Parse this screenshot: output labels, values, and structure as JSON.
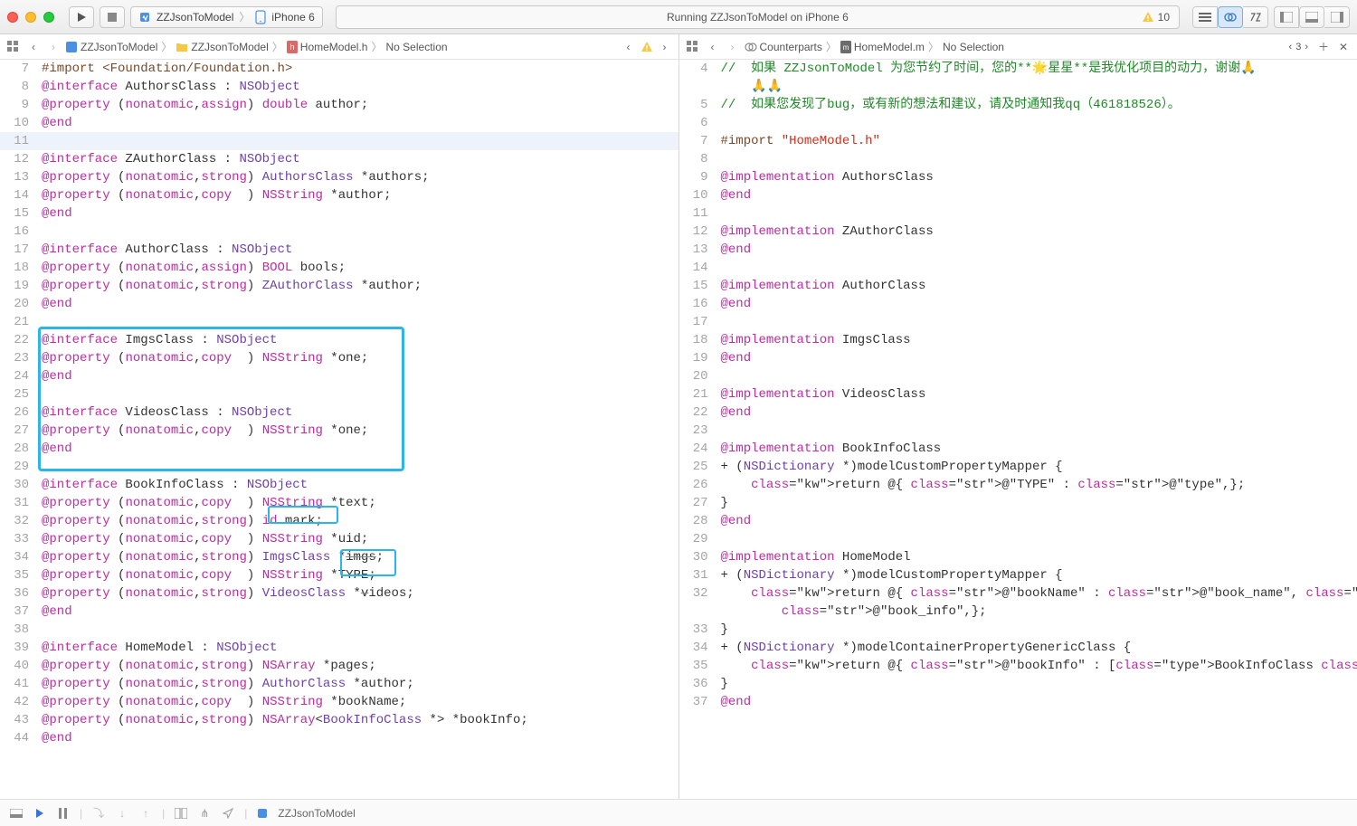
{
  "toolbar": {
    "scheme": "ZZJsonToModel",
    "destination": "iPhone 6",
    "status_text": "Running ZZJsonToModel on iPhone 6",
    "warning_count": "10"
  },
  "left_jump": {
    "project": "ZZJsonToModel",
    "folder": "ZZJsonToModel",
    "file": "HomeModel.h",
    "selection": "No Selection"
  },
  "right_jump": {
    "category": "Counterparts",
    "file": "HomeModel.m",
    "selection": "No Selection",
    "counter": "3"
  },
  "left_code": [
    {
      "n": "7",
      "t": "#import <Foundation/Foundation.h>",
      "c": "pre"
    },
    {
      "n": "8",
      "t": "@interface AuthorsClass : NSObject",
      "c": "int"
    },
    {
      "n": "9",
      "t": "@property (nonatomic,assign) double author;",
      "c": "prop2"
    },
    {
      "n": "10",
      "t": "@end",
      "c": "kw"
    },
    {
      "n": "11",
      "t": "",
      "c": "cur"
    },
    {
      "n": "12",
      "t": "@interface ZAuthorClass : NSObject",
      "c": "int"
    },
    {
      "n": "13",
      "t": "@property (nonatomic,strong) AuthorsClass *authors;",
      "c": "prop3"
    },
    {
      "n": "14",
      "t": "@property (nonatomic,copy  ) NSString *author;",
      "c": "prop"
    },
    {
      "n": "15",
      "t": "@end",
      "c": "kw"
    },
    {
      "n": "16",
      "t": "",
      "c": ""
    },
    {
      "n": "17",
      "t": "@interface AuthorClass : NSObject",
      "c": "int"
    },
    {
      "n": "18",
      "t": "@property (nonatomic,assign) BOOL bools;",
      "c": "prop2"
    },
    {
      "n": "19",
      "t": "@property (nonatomic,strong) ZAuthorClass *author;",
      "c": "prop3"
    },
    {
      "n": "20",
      "t": "@end",
      "c": "kw"
    },
    {
      "n": "21",
      "t": "",
      "c": ""
    },
    {
      "n": "22",
      "t": "@interface ImgsClass : NSObject",
      "c": "int"
    },
    {
      "n": "23",
      "t": "@property (nonatomic,copy  ) NSString *one;",
      "c": "prop"
    },
    {
      "n": "24",
      "t": "@end",
      "c": "kw"
    },
    {
      "n": "25",
      "t": "",
      "c": ""
    },
    {
      "n": "26",
      "t": "@interface VideosClass : NSObject",
      "c": "int"
    },
    {
      "n": "27",
      "t": "@property (nonatomic,copy  ) NSString *one;",
      "c": "prop"
    },
    {
      "n": "28",
      "t": "@end",
      "c": "kw"
    },
    {
      "n": "29",
      "t": "",
      "c": ""
    },
    {
      "n": "30",
      "t": "@interface BookInfoClass : NSObject",
      "c": "int"
    },
    {
      "n": "31",
      "t": "@property (nonatomic,copy  ) NSString *text;",
      "c": "prop"
    },
    {
      "n": "32",
      "t": "@property (nonatomic,strong) id mark;",
      "c": "prop2"
    },
    {
      "n": "33",
      "t": "@property (nonatomic,copy  ) NSString *uid;",
      "c": "prop"
    },
    {
      "n": "34",
      "t": "@property (nonatomic,strong) ImgsClass *imgs;",
      "c": "prop3s"
    },
    {
      "n": "35",
      "t": "@property (nonatomic,copy  ) NSString *TYPE;",
      "c": "prop"
    },
    {
      "n": "36",
      "t": "@property (nonatomic,strong) VideosClass *videos;",
      "c": "prop3s2"
    },
    {
      "n": "37",
      "t": "@end",
      "c": "kw"
    },
    {
      "n": "38",
      "t": "",
      "c": ""
    },
    {
      "n": "39",
      "t": "@interface HomeModel : NSObject",
      "c": "int"
    },
    {
      "n": "40",
      "t": "@property (nonatomic,strong) NSArray *pages;",
      "c": "prop"
    },
    {
      "n": "41",
      "t": "@property (nonatomic,strong) AuthorClass *author;",
      "c": "prop3"
    },
    {
      "n": "42",
      "t": "@property (nonatomic,copy  ) NSString *bookName;",
      "c": "prop"
    },
    {
      "n": "43",
      "t": "@property (nonatomic,strong) NSArray<BookInfoClass *> *bookInfo;",
      "c": "prop4"
    },
    {
      "n": "44",
      "t": "@end",
      "c": "kw"
    }
  ],
  "right_code": [
    {
      "n": "4",
      "t": "//  如果 ZZJsonToModel 为您节约了时间，您的**🌟星星**是我优化项目的动力，谢谢🙏",
      "c": "cmt"
    },
    {
      "n": "",
      "t": "    🙏🙏",
      "c": "cmt"
    },
    {
      "n": "5",
      "t": "//  如果您发现了bug，或有新的想法和建议，请及时通知我qq（461818526）。",
      "c": "cmt"
    },
    {
      "n": "6",
      "t": "",
      "c": ""
    },
    {
      "n": "7",
      "t": "#import \"HomeModel.h\"",
      "c": "imp"
    },
    {
      "n": "8",
      "t": "",
      "c": ""
    },
    {
      "n": "9",
      "t": "@implementation AuthorsClass",
      "c": "impl"
    },
    {
      "n": "10",
      "t": "@end",
      "c": "kw"
    },
    {
      "n": "11",
      "t": "",
      "c": ""
    },
    {
      "n": "12",
      "t": "@implementation ZAuthorClass",
      "c": "impl"
    },
    {
      "n": "13",
      "t": "@end",
      "c": "kw"
    },
    {
      "n": "14",
      "t": "",
      "c": ""
    },
    {
      "n": "15",
      "t": "@implementation AuthorClass",
      "c": "impl"
    },
    {
      "n": "16",
      "t": "@end",
      "c": "kw"
    },
    {
      "n": "17",
      "t": "",
      "c": ""
    },
    {
      "n": "18",
      "t": "@implementation ImgsClass",
      "c": "impl"
    },
    {
      "n": "19",
      "t": "@end",
      "c": "kw"
    },
    {
      "n": "20",
      "t": "",
      "c": ""
    },
    {
      "n": "21",
      "t": "@implementation VideosClass",
      "c": "impl"
    },
    {
      "n": "22",
      "t": "@end",
      "c": "kw"
    },
    {
      "n": "23",
      "t": "",
      "c": ""
    },
    {
      "n": "24",
      "t": "@implementation BookInfoClass",
      "c": "impl"
    },
    {
      "n": "25",
      "t": "+ (NSDictionary *)modelCustomPropertyMapper {",
      "c": "meth"
    },
    {
      "n": "26",
      "t": "    return @{ @\"TYPE\" : @\"type\",};",
      "c": "ret"
    },
    {
      "n": "27",
      "t": "}",
      "c": ""
    },
    {
      "n": "28",
      "t": "@end",
      "c": "kw"
    },
    {
      "n": "29",
      "t": "",
      "c": ""
    },
    {
      "n": "30",
      "t": "@implementation HomeModel",
      "c": "impl"
    },
    {
      "n": "31",
      "t": "+ (NSDictionary *)modelCustomPropertyMapper {",
      "c": "meth"
    },
    {
      "n": "32",
      "t": "    return @{ @\"bookName\" : @\"book_name\", @\"bookInfo\" : ",
      "c": "ret"
    },
    {
      "n": "",
      "t": "        @\"book_info\",};",
      "c": "ret"
    },
    {
      "n": "33",
      "t": "}",
      "c": ""
    },
    {
      "n": "34",
      "t": "+ (NSDictionary *)modelContainerPropertyGenericClass {",
      "c": "meth"
    },
    {
      "n": "35",
      "t": "    return @{ @\"bookInfo\" : [BookInfoClass class],};",
      "c": "ret2"
    },
    {
      "n": "36",
      "t": "}",
      "c": ""
    },
    {
      "n": "37",
      "t": "@end",
      "c": "kw"
    }
  ],
  "bottom": {
    "label": "ZZJsonToModel"
  }
}
